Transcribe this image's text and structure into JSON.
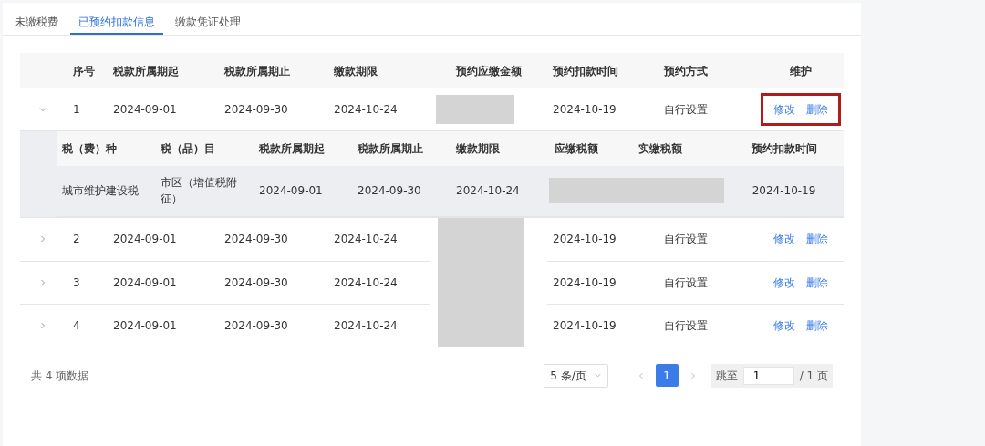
{
  "tabs": [
    {
      "label": "未缴税费",
      "selected": false
    },
    {
      "label": "已预约扣款信息",
      "selected": true
    },
    {
      "label": "缴款凭证处理",
      "selected": false
    }
  ],
  "table": {
    "columns": [
      "序号",
      "税款所属期起",
      "税款所属期止",
      "缴款期限",
      "预约应缴金额",
      "预约扣款时间",
      "预约方式",
      "维护"
    ],
    "rows": [
      {
        "seq": "1",
        "start": "2024-09-01",
        "end": "2024-09-30",
        "deadline": "2024-10-24",
        "time": "2024-10-19",
        "method": "自行设置",
        "actions": [
          "修改",
          "删除"
        ],
        "expanded": true,
        "highlighted": true,
        "detail": {
          "columns": [
            "税（费）种",
            "税（品）目",
            "税款所属期起",
            "税款所属期止",
            "缴款期限",
            "应缴税额",
            "实缴税额",
            "预约扣款时间"
          ],
          "rows": [
            {
              "cells": [
                {
                  "kind": "text",
                  "text": "城市维护建设税"
                },
                {
                  "kind": "text",
                  "text": "市区（增值税附征）"
                },
                {
                  "kind": "text",
                  "text": "2024-09-01"
                },
                {
                  "kind": "text",
                  "text": "2024-09-30"
                },
                {
                  "kind": "text",
                  "text": "2024-10-24"
                },
                {
                  "kind": "redacted"
                },
                {
                  "kind": "redacted"
                },
                {
                  "kind": "text",
                  "text": "2024-10-19"
                }
              ]
            }
          ]
        }
      },
      {
        "seq": "2",
        "start": "2024-09-01",
        "end": "2024-09-30",
        "deadline": "2024-10-24",
        "time": "2024-10-19",
        "method": "自行设置",
        "actions": [
          "修改",
          "删除"
        ],
        "expanded": false,
        "highlighted": false
      },
      {
        "seq": "3",
        "start": "2024-09-01",
        "end": "2024-09-30",
        "deadline": "2024-10-24",
        "time": "2024-10-19",
        "method": "自行设置",
        "actions": [
          "修改",
          "删除"
        ],
        "expanded": false,
        "highlighted": false
      },
      {
        "seq": "4",
        "start": "2024-09-01",
        "end": "2024-09-30",
        "deadline": "2024-10-24",
        "time": "2024-10-19",
        "method": "自行设置",
        "actions": [
          "修改",
          "删除"
        ],
        "expanded": false,
        "highlighted": false
      }
    ]
  },
  "pagination": {
    "total": "共 4 项数据",
    "page_size": "5 条/页",
    "pages": [
      {
        "label": "1",
        "selected": true
      }
    ],
    "jump_label": "跳至",
    "jump_value": "1",
    "page_count": "/ 1 页"
  }
}
